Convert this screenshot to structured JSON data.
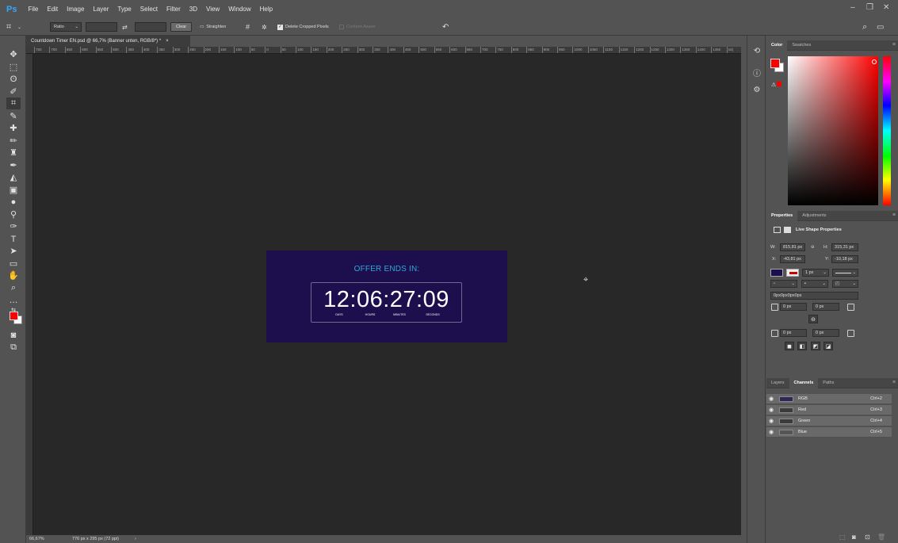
{
  "app": {
    "logo": "Ps",
    "menu": [
      "File",
      "Edit",
      "Image",
      "Layer",
      "Type",
      "Select",
      "Filter",
      "3D",
      "View",
      "Window",
      "Help"
    ],
    "window_controls": {
      "minimize": "–",
      "restore": "❐",
      "close": "✕"
    }
  },
  "options_bar": {
    "ratio_label": "Ratio",
    "swap_icon": "⇄",
    "clear_label": "Clear",
    "straighten_label": "Straighten",
    "delete_cropped_label": "Delete Cropped Pixels",
    "content_aware_label": "Content-Aware",
    "reset_icon": "↶",
    "search_icon": "⌕",
    "workspace_icon": "▭"
  },
  "document": {
    "tab_title": "Countdown Timer EN.psd @ 66,7% (Banner unten, RGB/8*) *",
    "tab_close": "×",
    "ruler_ticks": [
      "750",
      "700",
      "650",
      "600",
      "550",
      "500",
      "450",
      "400",
      "350",
      "300",
      "250",
      "200",
      "150",
      "100",
      "50",
      "0",
      "50",
      "100",
      "150",
      "200",
      "250",
      "300",
      "350",
      "400",
      "450",
      "500",
      "550",
      "600",
      "650",
      "700",
      "750",
      "800",
      "850",
      "900",
      "950",
      "1000",
      "1050",
      "1100",
      "1150",
      "1200",
      "1250",
      "1300",
      "1350",
      "1400",
      "1450",
      "15("
    ],
    "zoom": "66,67%",
    "doc_info": "776 px x 295 px (72 ppi)",
    "status_arrow": "›"
  },
  "banner": {
    "headline": "OFFER ENDS IN:",
    "timer": "12:06:27:09",
    "labels": [
      "DAYS",
      "HOURS",
      "MINUTES",
      "SECONDS"
    ],
    "bg_color": "#1d0f4d",
    "headline_color": "#30a8d8"
  },
  "color_panel": {
    "tabs": [
      "Color",
      "Swatches"
    ],
    "foreground": "#ff0000",
    "background": "#ffffff",
    "menu_icon": "≡"
  },
  "properties_panel": {
    "tabs": [
      "Properties",
      "Adjustments"
    ],
    "title": "Live Shape Properties",
    "w_label": "W:",
    "w_value": "815,81 px",
    "h_label": "H:",
    "h_value": "315,31 px",
    "x_label": "X:",
    "x_value": "-43,81 px",
    "y_label": "Y:",
    "y_value": "-10,18 px",
    "stroke_width": "1 px",
    "radius_summary": "0px0px0px0px",
    "radius_tl": "0 px",
    "radius_tr": "0 px",
    "radius_bl": "0 px",
    "radius_br": "0 px",
    "fill_color": "#1d0f4d",
    "link_icon": "⊖"
  },
  "channels_panel": {
    "tabs": [
      "Layers",
      "Channels",
      "Paths"
    ],
    "rows": [
      {
        "name": "RGB",
        "shortcut": "Ctrl+2"
      },
      {
        "name": "Red",
        "shortcut": "Ctrl+3"
      },
      {
        "name": "Green",
        "shortcut": "Ctrl+4"
      },
      {
        "name": "Blue",
        "shortcut": "Ctrl+5"
      }
    ]
  }
}
